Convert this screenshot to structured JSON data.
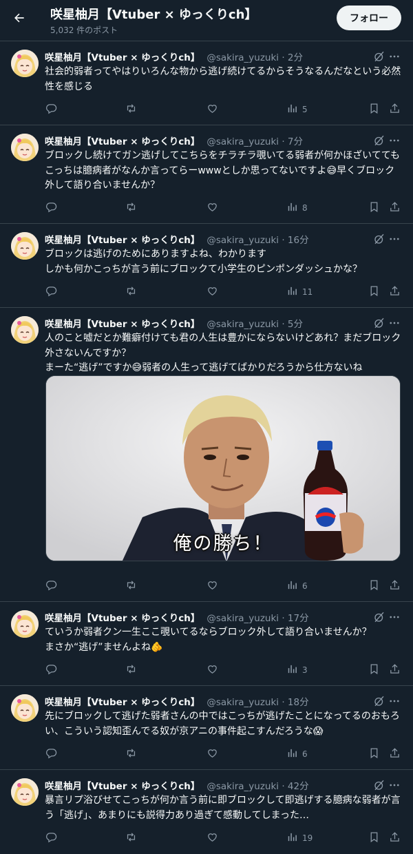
{
  "profile": {
    "name": "咲星柚月【Vtuber × ゆっくりch】",
    "post_count": "5,032 件のポスト",
    "follow_label": "フォロー",
    "handle": "@sakira_yuzuki"
  },
  "tweets": [
    {
      "time": "2分",
      "text": "社会的弱者ってやはりいろんな物から逃げ続けてるからそうなるんだなという必然性を感じる",
      "views": "5"
    },
    {
      "time": "7分",
      "text": "ブロックし続けてガン逃げしてこちらをチラチラ覗いてる弱者が何かほざいててもこっちは臆病者がなんか言ってらーwwwとしか思ってないですよ😅早くブロック外して語り合いませんか？",
      "views": "8"
    },
    {
      "time": "16分",
      "text": "ブロックは逃げのためにありますよね、わかります\nしかも何かこっちが言う前にブロックて小学生のピンポンダッシュかな？",
      "views": "11"
    },
    {
      "time": "5分",
      "text": "人のこと嘘だとか難癖付けても君の人生は豊かにならないけどあれ？まだブロック外さないんですか？\nまーた“逃げ”ですか😅弱者の人生って逃げてばかりだろうから仕方ないね",
      "views": "6",
      "media_caption": "俺の勝ち！"
    },
    {
      "time": "17分",
      "text": "ていうか弱者クン一生ここ覗いてるならブロック外して語り合いませんか？\nまさか“逃げ”ませんよね🫵",
      "views": "3"
    },
    {
      "time": "18分",
      "text": "先にブロックして逃げた弱者さんの中ではこっちが逃げたことになってるのおもろい、こういう認知歪んでる奴が京アニの事件起こすんだろうな😱",
      "views": "6"
    },
    {
      "time": "42分",
      "text": "暴言リプ浴びせてこっちが何か言う前に即ブロックして即逃げする臆病な弱者が言う「逃げ」、あまりにも説得力あり過ぎて感動してしまった…",
      "views": "19"
    }
  ],
  "colors": {
    "background": "#15202b",
    "border": "#38444d",
    "text": "#f7f9f9",
    "secondary": "#8b98a5",
    "follow_bg": "#eff3f4"
  },
  "icons": [
    "back-arrow-icon",
    "grok-icon",
    "more-icon",
    "reply-icon",
    "repost-icon",
    "like-icon",
    "views-icon",
    "bookmark-icon",
    "share-icon"
  ]
}
